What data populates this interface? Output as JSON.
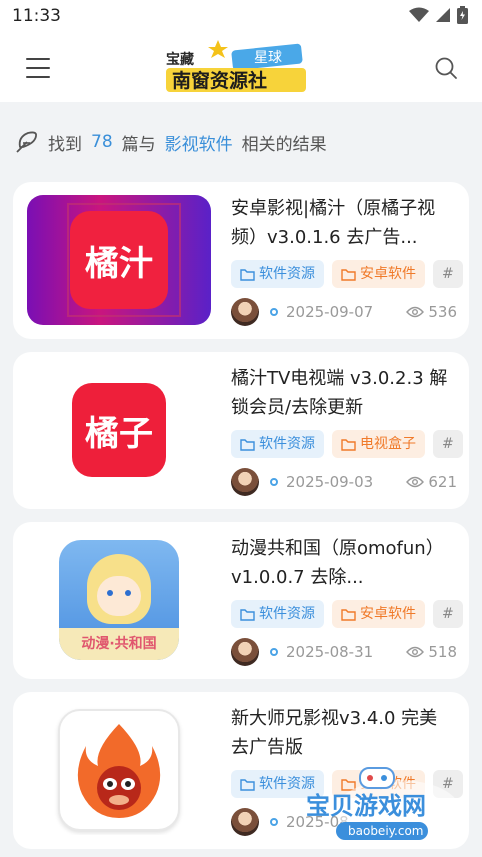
{
  "status_bar": {
    "time": "11:33"
  },
  "header": {
    "logo_text_top": "宝藏",
    "logo_text_tag": "星球",
    "logo_text_main": "南窗资源社"
  },
  "results": {
    "prefix": "找到",
    "count": "78",
    "middle": "篇与",
    "keyword": "影视软件",
    "suffix": "相关的结果"
  },
  "articles": [
    {
      "title": "安卓影视|橘汁（原橘子视频）v3.0.1.6 去广告...",
      "thumb_text": "橘汁",
      "tags": [
        "软件资源",
        "安卓软件",
        "#"
      ],
      "date": "2025-09-07",
      "views": "536"
    },
    {
      "title": "橘汁TV电视端 v3.0.2.3 解锁会员/去除更新",
      "thumb_text": "橘子",
      "tags": [
        "软件资源",
        "电视盒子",
        "#"
      ],
      "date": "2025-09-03",
      "views": "621"
    },
    {
      "title": "动漫共和国（原omofun）v1.0.0.7 去除...",
      "thumb_text": "动漫·共和国",
      "tags": [
        "软件资源",
        "安卓软件",
        "#"
      ],
      "date": "2025-08-31",
      "views": "518"
    },
    {
      "title": "新大师兄影视v3.4.0 完美去广告版",
      "thumb_text": "",
      "tags": [
        "软件资源",
        "安卓软件",
        "#"
      ],
      "date": "2025-08-",
      "views": ""
    }
  ],
  "watermark": {
    "text": "宝贝游戏网",
    "url": "baobeiy.com"
  },
  "colors": {
    "accent": "#3a8fd9",
    "tag_blue": "#3b8fdc",
    "tag_orange": "#f07a2a",
    "card_bg": "#ffffff",
    "page_bg": "#f1f3f5"
  }
}
